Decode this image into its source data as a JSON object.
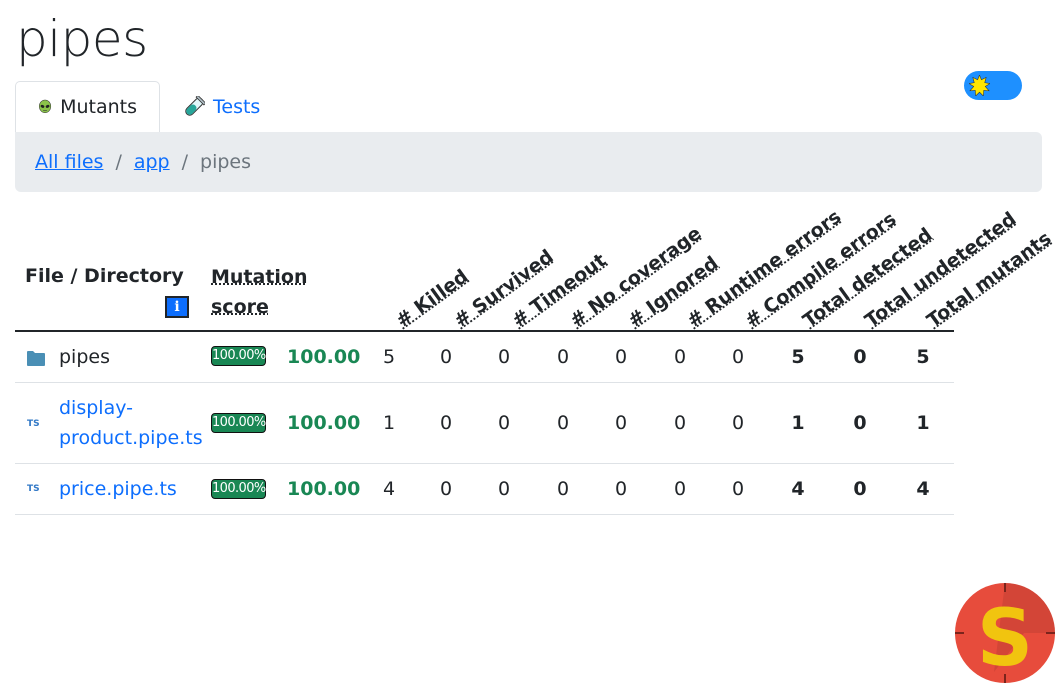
{
  "page": {
    "title": "pipes"
  },
  "tabs": [
    {
      "label": "Mutants",
      "icon": "alien-icon",
      "active": true
    },
    {
      "label": "Tests",
      "icon": "test-tube-icon",
      "active": false
    }
  ],
  "breadcrumb": {
    "items": [
      "All files",
      "app"
    ],
    "separator": "/",
    "current": "pipes"
  },
  "table": {
    "headers": {
      "file": "File / Directory",
      "info": "i",
      "score_line1": "Mutation",
      "score_line2": "score",
      "columns": [
        "# Killed",
        "# Survived",
        "# Timeout",
        "# No coverage",
        "# Ignored",
        "# Runtime errors",
        "# Compile errors",
        "Total detected",
        "Total undetected",
        "Total mutants"
      ]
    },
    "rows": [
      {
        "name": "pipes",
        "type": "folder",
        "badge": "100.00%",
        "score": "100.00",
        "values": [
          "5",
          "0",
          "0",
          "0",
          "0",
          "0",
          "0",
          "5",
          "0",
          "5"
        ]
      },
      {
        "name_line1": "display-",
        "name_line2": "product.pipe.ts",
        "type": "ts",
        "type_label": "TS",
        "badge": "100.00%",
        "score": "100.00",
        "values": [
          "1",
          "0",
          "0",
          "0",
          "0",
          "0",
          "0",
          "1",
          "0",
          "1"
        ]
      },
      {
        "name": "price.pipe.ts",
        "type": "ts",
        "type_label": "TS",
        "badge": "100.00%",
        "score": "100.00",
        "values": [
          "4",
          "0",
          "0",
          "0",
          "0",
          "0",
          "0",
          "4",
          "0",
          "4"
        ]
      }
    ]
  },
  "colors": {
    "accent": "#0d6efd",
    "success": "#198754",
    "breadcrumb_bg": "#e9ecef",
    "toggle": "#1e90ff"
  }
}
